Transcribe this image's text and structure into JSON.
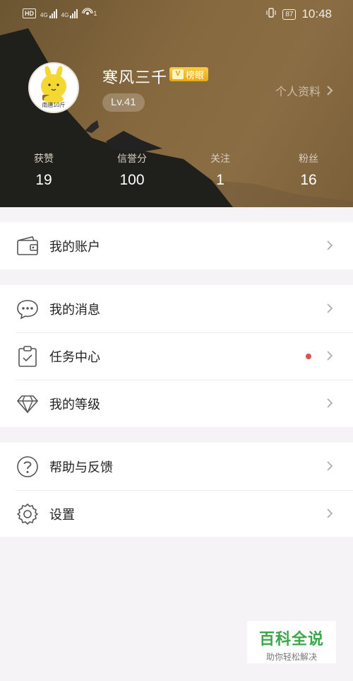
{
  "status_bar": {
    "left_badge": "HD",
    "signal_1": "4G",
    "signal_2": "4G",
    "notification_count": "1",
    "battery": "87",
    "time": "10:48"
  },
  "profile": {
    "username": "寒风三千",
    "badge": "榜眼",
    "level": "Lv.41",
    "profile_link": "个人资料",
    "avatar_caption": "南唐10斤",
    "colors": {
      "accent_badge": "#f0b62a",
      "header_bg": "#87693f"
    }
  },
  "stats": [
    {
      "label": "获赞",
      "value": "19"
    },
    {
      "label": "信誉分",
      "value": "100"
    },
    {
      "label": "关注",
      "value": "1"
    },
    {
      "label": "粉丝",
      "value": "16"
    }
  ],
  "menu": {
    "account": {
      "label": "我的账户",
      "icon": "wallet-icon"
    },
    "messages": {
      "label": "我的消息",
      "icon": "chat-bubble-icon"
    },
    "tasks": {
      "label": "任务中心",
      "icon": "clipboard-check-icon",
      "has_dot": true
    },
    "level": {
      "label": "我的等级",
      "icon": "diamond-icon"
    },
    "help": {
      "label": "帮助与反馈",
      "icon": "question-circle-icon"
    },
    "settings": {
      "label": "设置",
      "icon": "gear-icon"
    }
  },
  "watermark": {
    "title": "百科全说",
    "subtitle": "助你轻松解决"
  }
}
